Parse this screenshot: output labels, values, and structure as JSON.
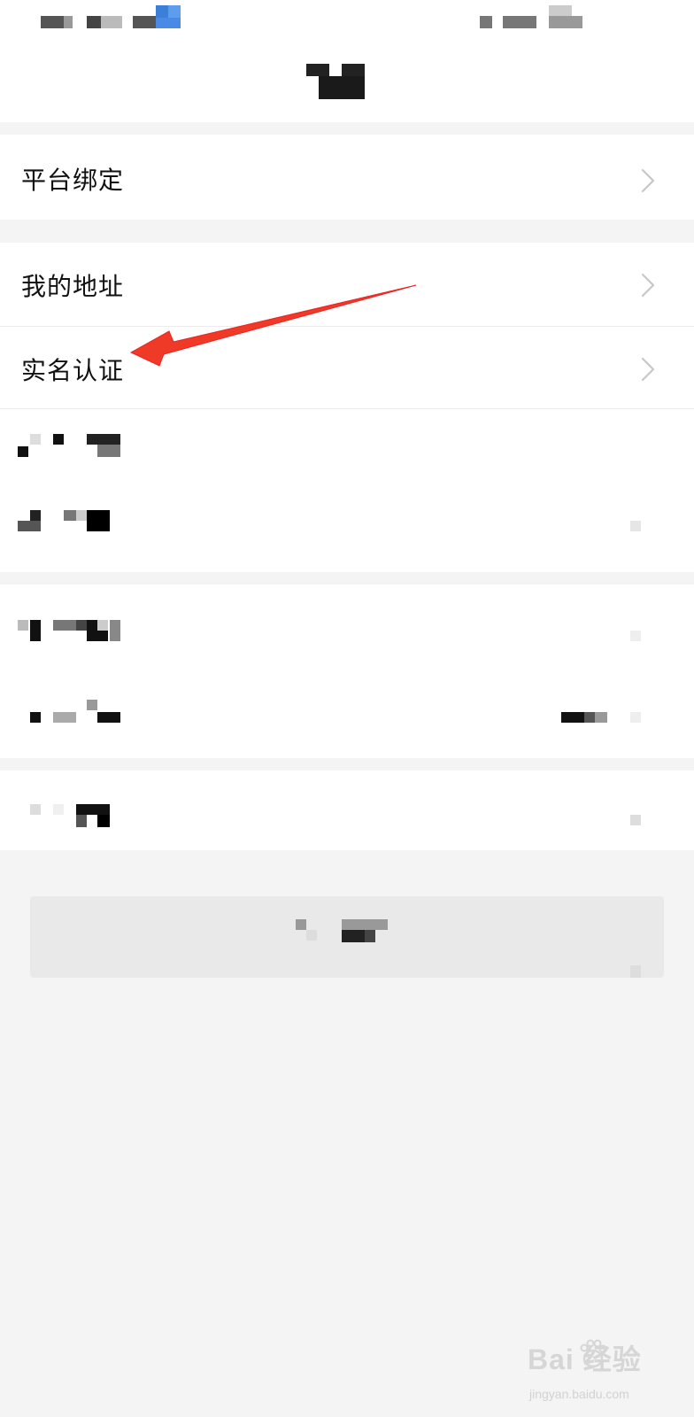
{
  "header": {
    "status_bar": "blurred",
    "title": "blurred"
  },
  "menu": {
    "platform_binding_label": "平台绑定",
    "my_address_label": "我的地址",
    "real_name_auth_label": "实名认证"
  },
  "annotation": {
    "arrow_color": "#ee3a26"
  },
  "watermark": {
    "brand": "Bai 经验",
    "url": "jingyan.baidu.com"
  },
  "colors": {
    "background": "#f4f4f4",
    "row_background": "#ffffff",
    "text": "#111111",
    "chevron": "#c7c7c7"
  }
}
